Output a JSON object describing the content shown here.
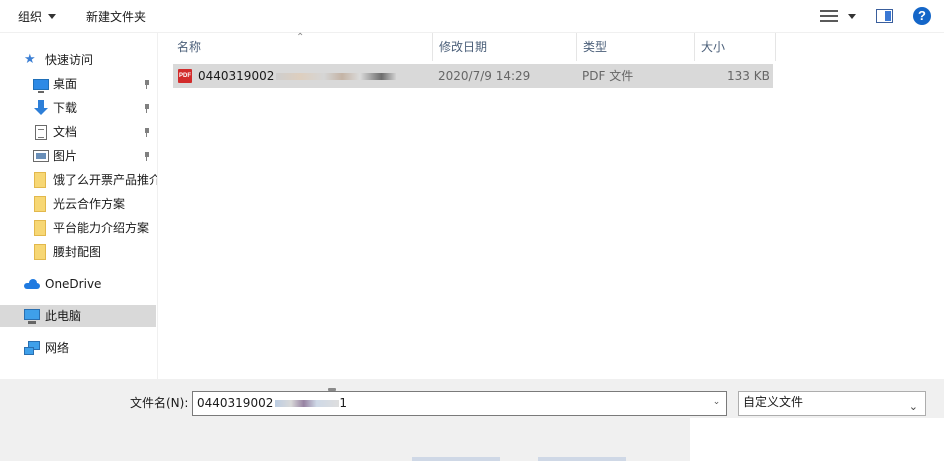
{
  "toolbar": {
    "organize_label": "组织",
    "new_folder_label": "新建文件夹",
    "view_icon": "view-options-icon",
    "preview_icon": "preview-pane-icon",
    "help_icon": "help-icon",
    "help_glyph": "?"
  },
  "nav": {
    "quick_access": "快速访问",
    "items": [
      {
        "label": "桌面",
        "icon": "desktop-icon",
        "pinned": true
      },
      {
        "label": "下载",
        "icon": "download-icon",
        "pinned": true
      },
      {
        "label": "文档",
        "icon": "document-icon",
        "pinned": true
      },
      {
        "label": "图片",
        "icon": "picture-icon",
        "pinned": true
      },
      {
        "label": "饿了么开票产品推介",
        "icon": "folder-icon",
        "pinned": false
      },
      {
        "label": "光云合作方案",
        "icon": "folder-icon",
        "pinned": false
      },
      {
        "label": "平台能力介绍方案",
        "icon": "folder-icon",
        "pinned": false
      },
      {
        "label": "腰封配图",
        "icon": "folder-icon",
        "pinned": false
      }
    ],
    "onedrive": "OneDrive",
    "this_pc": "此电脑",
    "network": "网络"
  },
  "list": {
    "columns": [
      "名称",
      "修改日期",
      "类型",
      "大小"
    ],
    "rows": [
      {
        "name": "0440319002",
        "modified": "2020/7/9 14:29",
        "type": "PDF 文件",
        "size": "133 KB",
        "icon": "pdf-file-icon"
      }
    ],
    "pdf_badge": "PDF"
  },
  "bottom": {
    "filename_label": "文件名(N):",
    "filename_value": "0440319002",
    "filename_suffix": "1",
    "filetype_value": "自定义文件"
  },
  "colors": {
    "selection": "#d9d9d9",
    "header_text": "#4c607a",
    "accent_blue": "#1466c8",
    "pdf_red": "#d22b2b",
    "folder_yellow": "#f7d774"
  }
}
